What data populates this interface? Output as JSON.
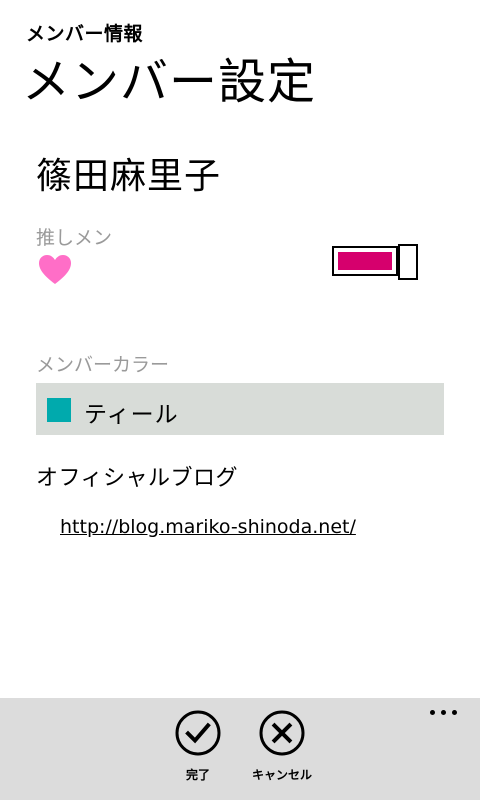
{
  "header": {
    "app_title": "メンバー情報",
    "page_title": "メンバー設定"
  },
  "member": {
    "name": "篠田麻里子"
  },
  "oshimen": {
    "label": "推しメン",
    "icon": "heart-icon",
    "heart_color": "#ff6ec7",
    "toggle_on": true,
    "toggle_color": "#d6006d"
  },
  "member_color": {
    "label": "メンバーカラー",
    "selected": "ティール",
    "swatch_color": "#00aaad"
  },
  "blog": {
    "label": "オフィシャルブログ",
    "url": "http://blog.mariko-shinoda.net/"
  },
  "app_bar": {
    "buttons": [
      {
        "label": "完了",
        "icon": "check-icon"
      },
      {
        "label": "キャンセル",
        "icon": "close-icon"
      }
    ],
    "more_icon": "ellipsis-icon"
  }
}
